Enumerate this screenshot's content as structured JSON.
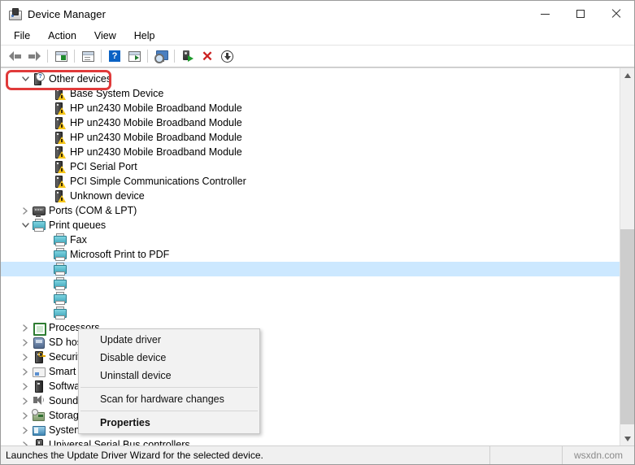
{
  "window": {
    "title": "Device Manager",
    "icon": "device-manager-icon",
    "controls": {
      "minimize": "–",
      "maximize": "□",
      "close": "✕"
    }
  },
  "menubar": {
    "items": [
      {
        "label": "File"
      },
      {
        "label": "Action"
      },
      {
        "label": "View"
      },
      {
        "label": "Help"
      }
    ]
  },
  "toolbar": {
    "buttons": [
      {
        "name": "back-arrow-icon",
        "title": "Back"
      },
      {
        "name": "forward-arrow-icon",
        "title": "Forward"
      },
      {
        "name": "show-hide-console-tree-icon",
        "title": "Show/Hide Console Tree"
      },
      {
        "name": "properties-icon",
        "title": "Properties"
      },
      {
        "name": "help-icon",
        "title": "Help"
      },
      {
        "name": "scan-view-icon",
        "title": "View"
      },
      {
        "name": "scan-for-hardware-changes-icon",
        "title": "Scan for hardware changes"
      },
      {
        "name": "update-driver-icon",
        "title": "Update driver"
      },
      {
        "name": "uninstall-device-icon",
        "title": "Uninstall device"
      },
      {
        "name": "disable-device-icon",
        "title": "Disable device"
      }
    ]
  },
  "tree": {
    "items": [
      {
        "label": "Other devices",
        "indent": 0,
        "chevron": "down",
        "icon": "unknown-device-icon",
        "selected": false
      },
      {
        "label": "Base System Device",
        "indent": 1,
        "chevron": "none",
        "icon": "warning-device-icon",
        "selected": false
      },
      {
        "label": "HP un2430 Mobile Broadband Module",
        "indent": 1,
        "chevron": "none",
        "icon": "warning-device-icon",
        "selected": false
      },
      {
        "label": "HP un2430 Mobile Broadband Module",
        "indent": 1,
        "chevron": "none",
        "icon": "warning-device-icon",
        "selected": false
      },
      {
        "label": "HP un2430 Mobile Broadband Module",
        "indent": 1,
        "chevron": "none",
        "icon": "warning-device-icon",
        "selected": false
      },
      {
        "label": "HP un2430 Mobile Broadband Module",
        "indent": 1,
        "chevron": "none",
        "icon": "warning-device-icon",
        "selected": false
      },
      {
        "label": "PCI Serial Port",
        "indent": 1,
        "chevron": "none",
        "icon": "warning-device-icon",
        "selected": false
      },
      {
        "label": "PCI Simple Communications Controller",
        "indent": 1,
        "chevron": "none",
        "icon": "warning-device-icon",
        "selected": false
      },
      {
        "label": "Unknown device",
        "indent": 1,
        "chevron": "none",
        "icon": "warning-device-icon",
        "selected": false
      },
      {
        "label": "Ports (COM & LPT)",
        "indent": 0,
        "chevron": "right",
        "icon": "port-icon",
        "selected": false
      },
      {
        "label": "Print queues",
        "indent": 0,
        "chevron": "down",
        "icon": "printer-icon",
        "selected": false
      },
      {
        "label": "Fax",
        "indent": 1,
        "chevron": "none",
        "icon": "printer-icon",
        "selected": false
      },
      {
        "label": "Microsoft Print to PDF",
        "indent": 1,
        "chevron": "none",
        "icon": "printer-icon",
        "selected": false
      },
      {
        "label": "",
        "indent": 1,
        "chevron": "none",
        "icon": "printer-icon",
        "selected": true
      },
      {
        "label": "",
        "indent": 1,
        "chevron": "none",
        "icon": "printer-icon",
        "selected": false
      },
      {
        "label": "",
        "indent": 1,
        "chevron": "none",
        "icon": "printer-icon",
        "selected": false
      },
      {
        "label": "",
        "indent": 1,
        "chevron": "none",
        "icon": "printer-icon",
        "selected": false
      },
      {
        "label": "Processors",
        "indent": 0,
        "chevron": "right",
        "icon": "processor-icon",
        "selected": false
      },
      {
        "label": "SD host adapters",
        "indent": 0,
        "chevron": "right",
        "icon": "sd-card-icon",
        "selected": false
      },
      {
        "label": "Security devices",
        "indent": 0,
        "chevron": "right",
        "icon": "security-device-icon",
        "selected": false
      },
      {
        "label": "Smart card readers",
        "indent": 0,
        "chevron": "right",
        "icon": "smart-card-reader-icon",
        "selected": false
      },
      {
        "label": "Software devices",
        "indent": 0,
        "chevron": "right",
        "icon": "software-device-icon",
        "selected": false
      },
      {
        "label": "Sound, video and game controllers",
        "indent": 0,
        "chevron": "right",
        "icon": "speaker-icon",
        "selected": false
      },
      {
        "label": "Storage controllers",
        "indent": 0,
        "chevron": "right",
        "icon": "storage-controller-icon",
        "selected": false
      },
      {
        "label": "System devices",
        "indent": 0,
        "chevron": "right",
        "icon": "system-device-icon",
        "selected": false
      },
      {
        "label": "Universal Serial Bus controllers",
        "indent": 0,
        "chevron": "right",
        "icon": "usb-icon",
        "selected": false
      }
    ]
  },
  "context_menu": {
    "items": [
      {
        "label": "Update driver",
        "bold": false,
        "highlighted": true
      },
      {
        "label": "Disable device",
        "bold": false,
        "highlighted": false
      },
      {
        "label": "Uninstall device",
        "bold": false,
        "highlighted": false
      },
      {
        "label": "__separator__",
        "bold": false,
        "highlighted": false
      },
      {
        "label": "Scan for hardware changes",
        "bold": false,
        "highlighted": false
      },
      {
        "label": "__separator__",
        "bold": false,
        "highlighted": false
      },
      {
        "label": "Properties",
        "bold": true,
        "highlighted": false
      }
    ],
    "highlight_color": "#e03a3a"
  },
  "statusbar": {
    "text": "Launches the Update Driver Wizard for the selected device.",
    "watermark": "wsxdn.com"
  },
  "scrollbar": {
    "up_arrow": "▲",
    "down_arrow": "▼"
  },
  "colors": {
    "selection": "#cce8ff",
    "accent_red": "#e03a3a",
    "titlebar": "#ffffff"
  }
}
